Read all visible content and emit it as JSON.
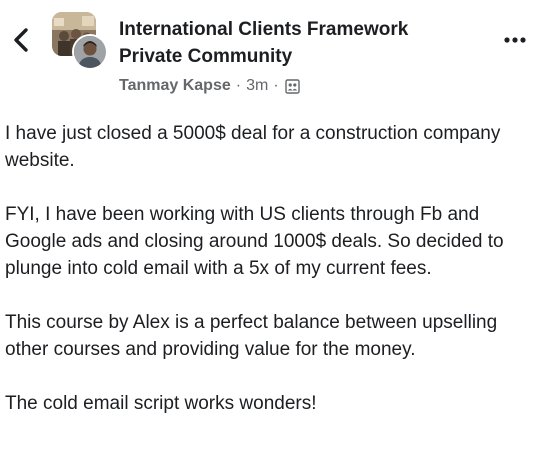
{
  "header": {
    "back_icon": "chevron-left-icon",
    "group_name_line1": "International Clients Framework",
    "group_name_line2": "Private Community",
    "author": "Tanmay Kapse",
    "separator": "·",
    "time": "3m",
    "privacy_icon": "members-group-icon",
    "more_icon": "more-horizontal-icon"
  },
  "post": {
    "paragraphs": [
      "I have just closed a 5000$ deal for a construction company website.",
      "FYI, I have been working with US clients through Fb and Google ads and closing around 1000$ deals. So decided to plunge into cold email with a 5x of my current fees.",
      "This course by Alex is a perfect balance between upselling other courses and providing value for the money.",
      "The cold email script works wonders!"
    ]
  },
  "colors": {
    "text_primary": "#1c1e21",
    "text_secondary": "#65676b",
    "background": "#ffffff"
  }
}
